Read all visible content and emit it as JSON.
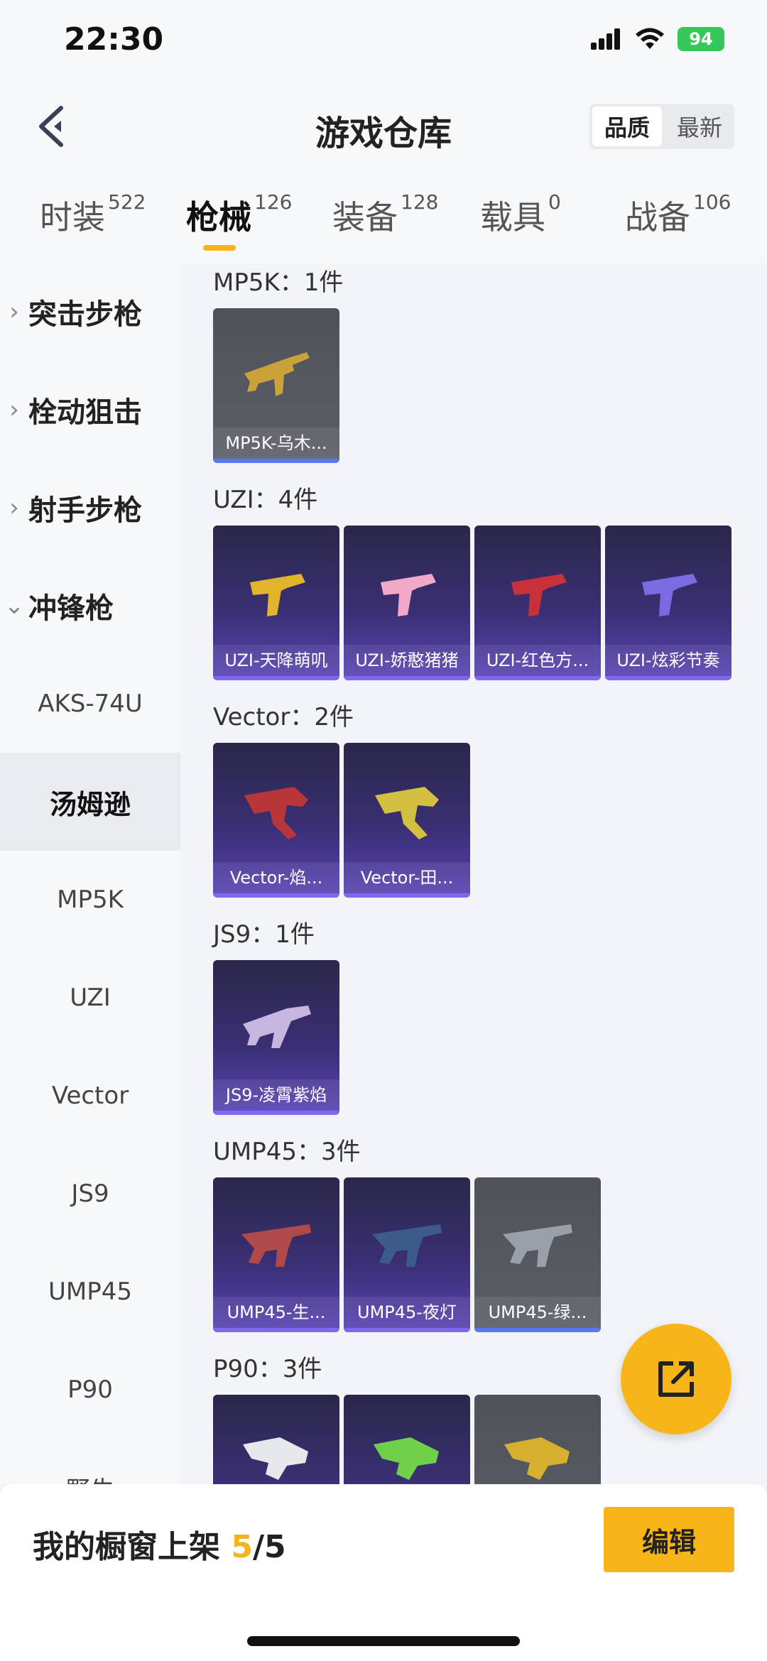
{
  "status": {
    "time": "22:30",
    "battery": "94"
  },
  "header": {
    "title": "游戏仓库",
    "sort_options": [
      "品质",
      "最新"
    ]
  },
  "tabs": [
    {
      "label": "时装",
      "count": "522"
    },
    {
      "label": "枪械",
      "count": "126"
    },
    {
      "label": "装备",
      "count": "128"
    },
    {
      "label": "载具",
      "count": "0"
    },
    {
      "label": "战备",
      "count": "106"
    }
  ],
  "sidebar": {
    "categories": [
      {
        "label": "突击步枪",
        "chevron": "›"
      },
      {
        "label": "栓动狙击",
        "chevron": "›"
      },
      {
        "label": "射手步枪",
        "chevron": "›"
      },
      {
        "label": "冲锋枪",
        "chevron": "⌄"
      }
    ],
    "subs": [
      "AKS-74U",
      "汤姆逊",
      "MP5K",
      "UZI",
      "Vector",
      "JS9",
      "UMP45",
      "P90",
      "野牛"
    ]
  },
  "groups": [
    {
      "title": "MP5K：1件",
      "items": [
        {
          "name": "MP5K-乌木...",
          "rarity": "gray"
        }
      ]
    },
    {
      "title": "UZI：4件",
      "items": [
        {
          "name": "UZI-天降萌叽",
          "rarity": "purple"
        },
        {
          "name": "UZI-娇憨猪猪",
          "rarity": "purple"
        },
        {
          "name": "UZI-红色方...",
          "rarity": "purple"
        },
        {
          "name": "UZI-炫彩节奏",
          "rarity": "purple"
        }
      ]
    },
    {
      "title": "Vector：2件",
      "items": [
        {
          "name": "Vector-焰...",
          "rarity": "purple"
        },
        {
          "name": "Vector-田...",
          "rarity": "purple"
        }
      ]
    },
    {
      "title": "JS9：1件",
      "items": [
        {
          "name": "JS9-凌霄紫焰",
          "rarity": "purple"
        }
      ]
    },
    {
      "title": "UMP45：3件",
      "items": [
        {
          "name": "UMP45-生...",
          "rarity": "purple"
        },
        {
          "name": "UMP45-夜灯",
          "rarity": "purple"
        },
        {
          "name": "UMP45-绿...",
          "rarity": "gray"
        }
      ]
    },
    {
      "title": "P90：3件",
      "items": [
        {
          "name": "",
          "rarity": "purple"
        },
        {
          "name": "",
          "rarity": "purple"
        },
        {
          "name": "",
          "rarity": "gray"
        }
      ]
    }
  ],
  "gun_colors": [
    "#c9a23a",
    "#e0b52b",
    "#f2a8c8",
    "#c8303a",
    "#7a6be0",
    "#b8353a",
    "#d4c040",
    "#c7b6e0",
    "#b04a4a",
    "#3c5a8a",
    "#9aa0aa",
    "#e6e8ee",
    "#6fd04a",
    "#d8b030"
  ],
  "bottom": {
    "shelf_label": "我的橱窗上架 ",
    "shelf_current": "5",
    "shelf_total": "/5",
    "edit_label": "编辑"
  },
  "colors": {
    "accent": "#f8b51a",
    "rarity_purple": "#5a43b5",
    "rarity_gray": "#5b5e66"
  }
}
